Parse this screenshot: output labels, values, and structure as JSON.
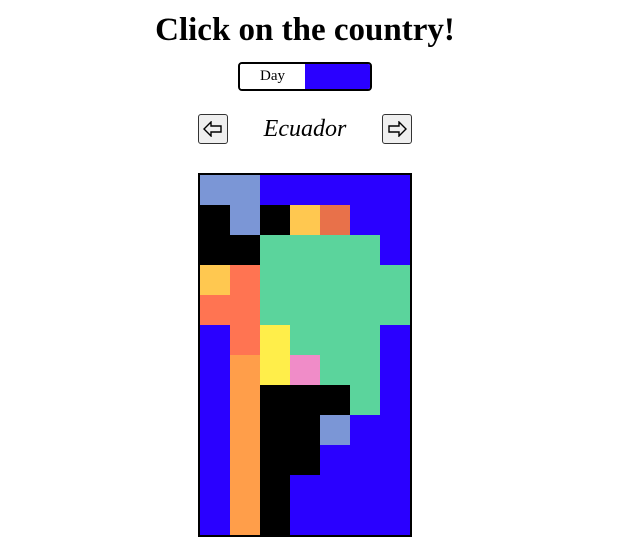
{
  "title": "Click on the country!",
  "toggle": {
    "label": "Day",
    "off_color": "#ffffff",
    "on_color": "#2a00ff"
  },
  "nav": {
    "prev_icon": "left-arrow-icon",
    "next_icon": "right-arrow-icon"
  },
  "current_country": "Ecuador",
  "map": {
    "ocean_color": "#2a00ff",
    "columns": 7,
    "rows": 12,
    "palette": {
      "O": "#2a00ff",
      "K": "#000000",
      "L": "#7b96d6",
      "Y": "#ffc850",
      "R": "#e8714a",
      "G": "#5bd49c",
      "S": "#ff7452",
      "B": "#ff9e4a",
      "W": "#ffee4a",
      "P": "#f08cc8"
    },
    "grid": [
      "LLOOOOO",
      "KLKYROO",
      "KKGGGGO",
      "YSGGGGG",
      "SSGGGGG",
      "OSWGGGO",
      "OBWPGGO",
      "OBKKKGO",
      "OBKKLOO",
      "OBKKOOO",
      "OBKOOOO",
      "OBKOOOO"
    ]
  }
}
